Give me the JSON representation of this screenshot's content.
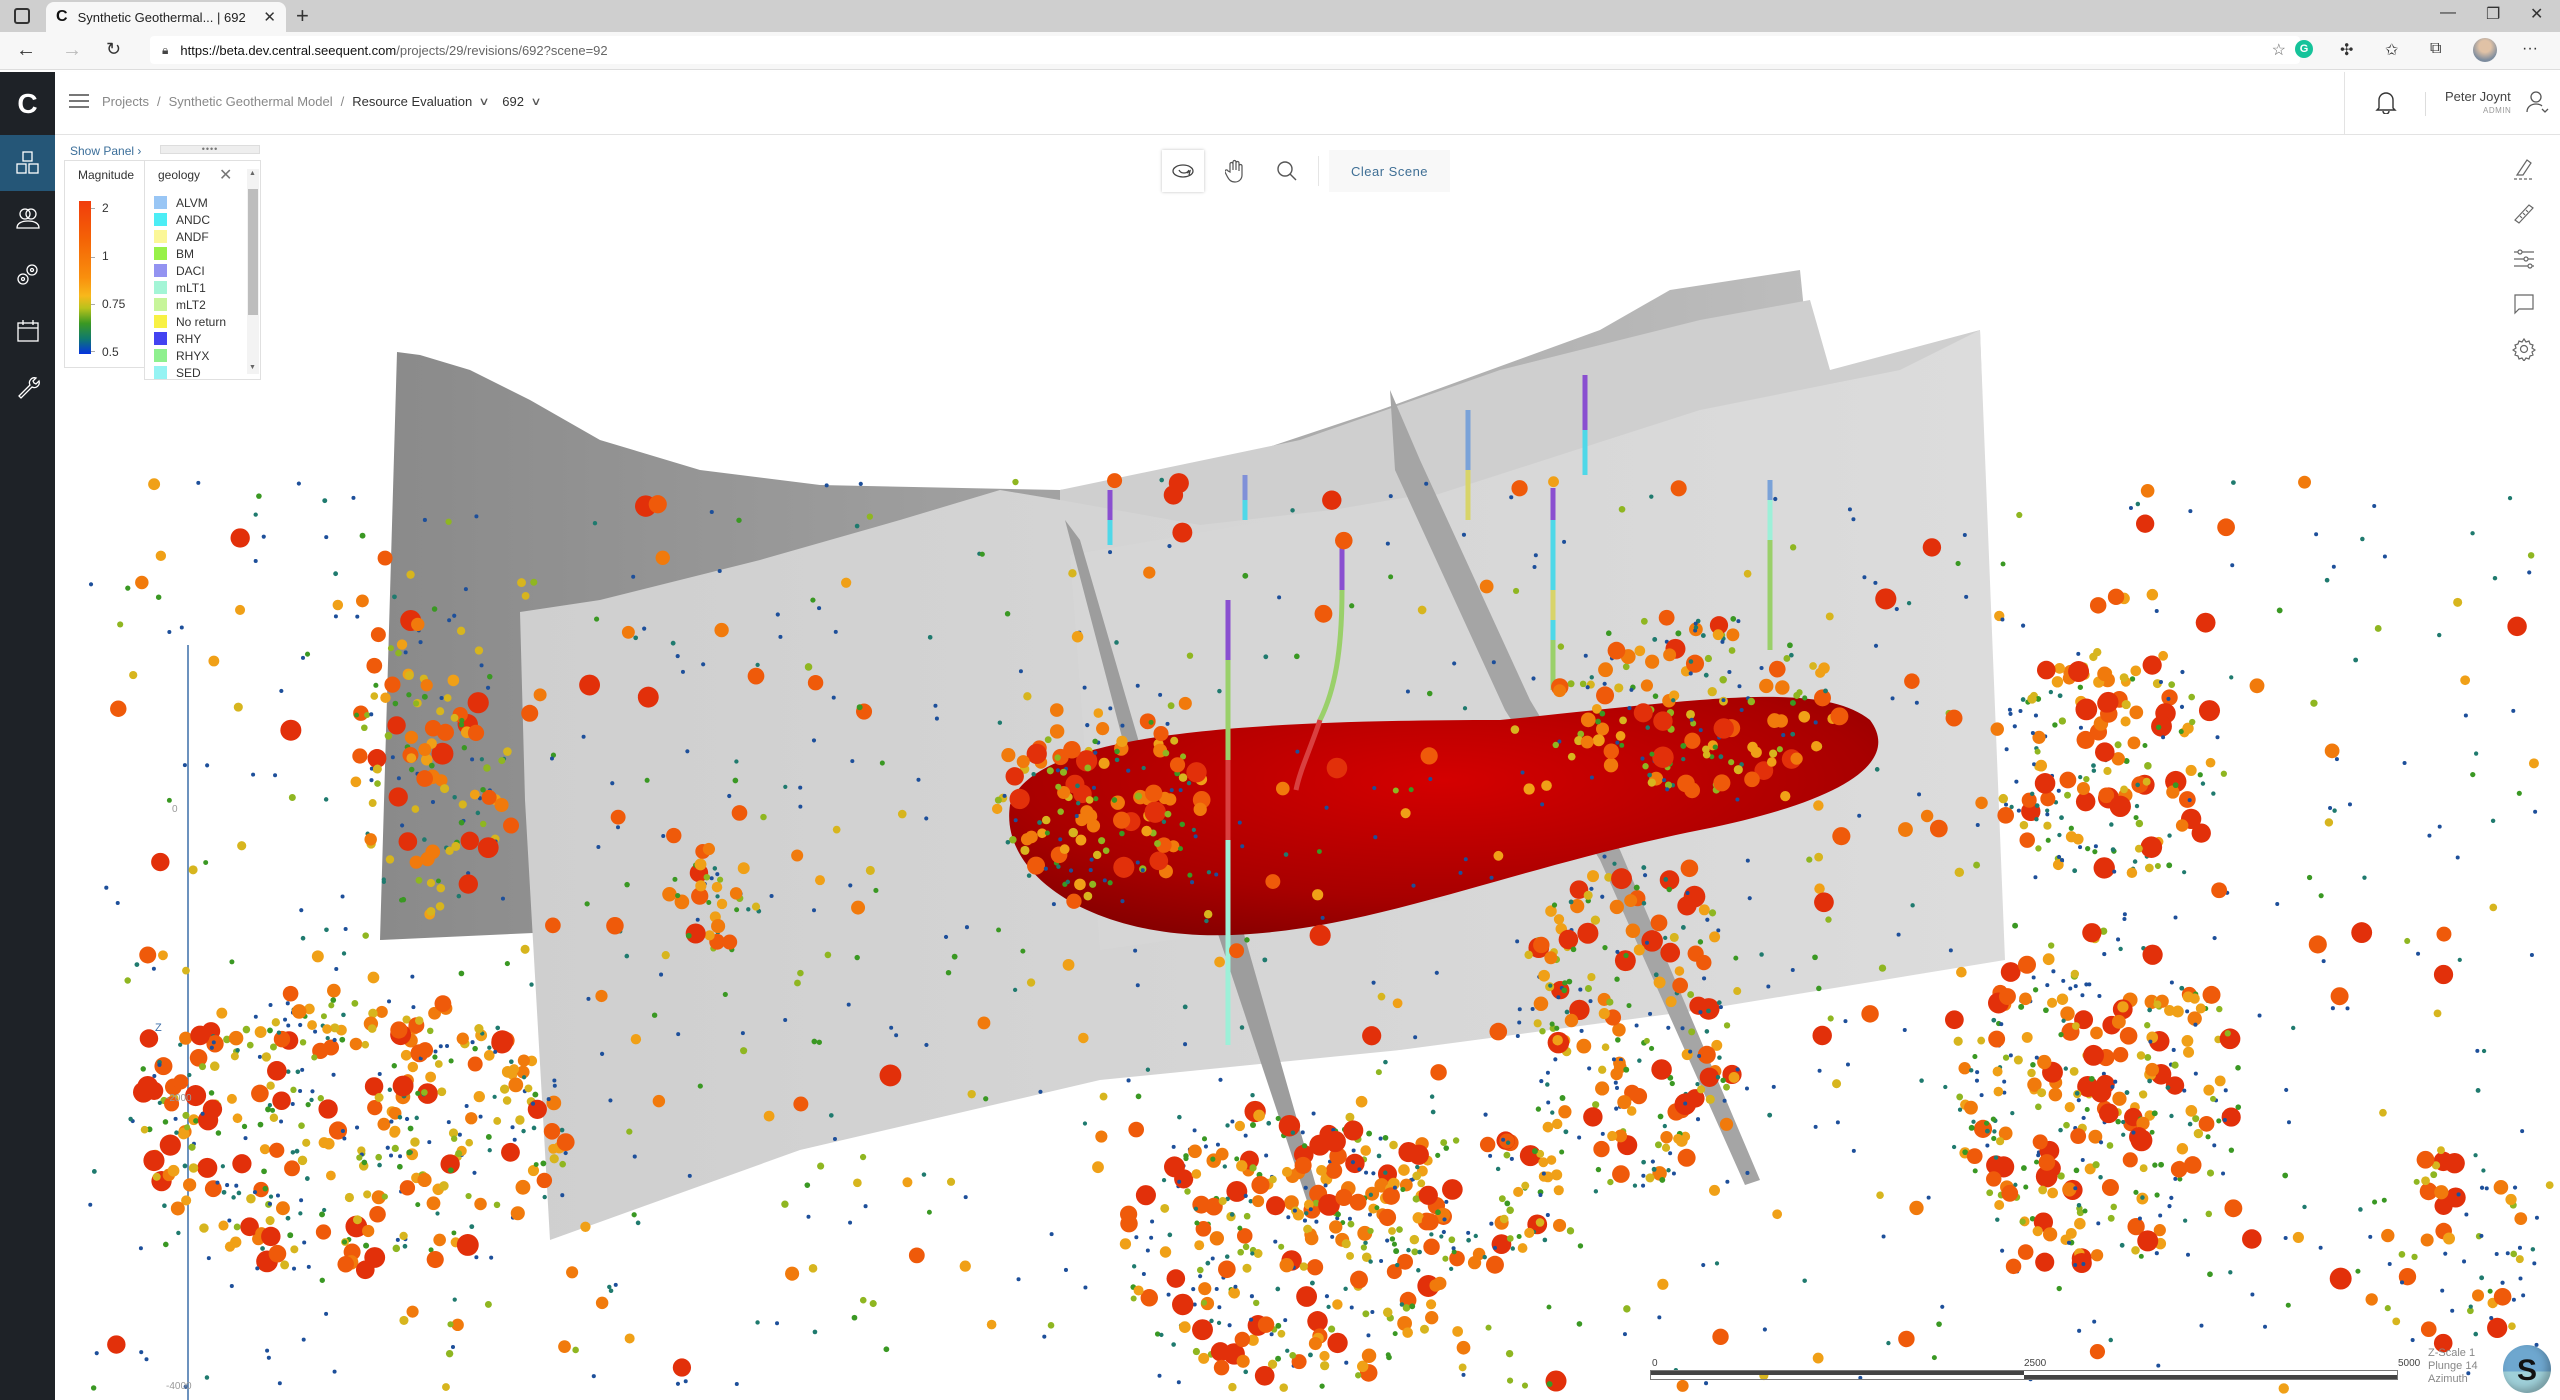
{
  "browser": {
    "tab_title": "Synthetic Geothermal... | 692",
    "tab_favicon": "C",
    "url_host": "https://beta.dev.central.seequent.com",
    "url_path": "/projects/29/revisions/692?scene=92"
  },
  "app": {
    "logo": "C",
    "sidebar": [
      {
        "name": "models",
        "icon": "cubes-icon",
        "active": true
      },
      {
        "name": "users",
        "icon": "users-icon",
        "active": false
      },
      {
        "name": "settings",
        "icon": "gears-icon",
        "active": false
      },
      {
        "name": "calendar",
        "icon": "calendar-icon",
        "active": false
      },
      {
        "name": "tools",
        "icon": "wrench-icon",
        "active": false
      }
    ],
    "breadcrumb": {
      "projects": "Projects",
      "sep": "/",
      "project": "Synthetic Geothermal Model",
      "branch": "Resource Evaluation",
      "revision": "692"
    },
    "user": {
      "name": "Peter Joynt",
      "role": "ADMIN"
    }
  },
  "legend": {
    "show_panel": "Show Panel",
    "magnitude": {
      "title": "Magnitude",
      "ticks": [
        "2",
        "1",
        "0.75",
        "0.5"
      ]
    },
    "geology": {
      "title": "geology",
      "items": [
        {
          "label": "ALVM",
          "color": "#99c6f5"
        },
        {
          "label": "ANDC",
          "color": "#4cedf5"
        },
        {
          "label": "ANDF",
          "color": "#fbf797"
        },
        {
          "label": "BM",
          "color": "#97f148"
        },
        {
          "label": "DACI",
          "color": "#9393f1"
        },
        {
          "label": "mLT1",
          "color": "#a3f5d6"
        },
        {
          "label": "mLT2",
          "color": "#c7f59a"
        },
        {
          "label": "No return",
          "color": "#f8f144"
        },
        {
          "label": "RHY",
          "color": "#4343f1"
        },
        {
          "label": "RHYX",
          "color": "#8ef08e"
        },
        {
          "label": "SED",
          "color": "#95f3f3"
        }
      ]
    }
  },
  "toolbar": {
    "tools": [
      "orbit-tool",
      "pan-tool",
      "zoom-tool"
    ],
    "clear_label": "Clear Scene"
  },
  "right_tools": [
    "slice-tool",
    "measure-tool",
    "filter-tool",
    "comment-tool",
    "settings-tool"
  ],
  "scene": {
    "z_axis_labels": [
      "0",
      "-2000",
      "-4000"
    ],
    "z_axis_name": "Z",
    "scale_labels": [
      "0",
      "2500",
      "5000"
    ],
    "orientation": {
      "labels": [
        "Z-Scale",
        "Plunge",
        "Azimuth"
      ],
      "values": [
        "1",
        "14",
        ""
      ]
    },
    "compass_label": "S",
    "colors": {
      "surface_dark": "#8c8c8c",
      "surface_light": "#d9d9d9",
      "reservoir": "#c40000",
      "accent": "#3c6f9a"
    }
  }
}
